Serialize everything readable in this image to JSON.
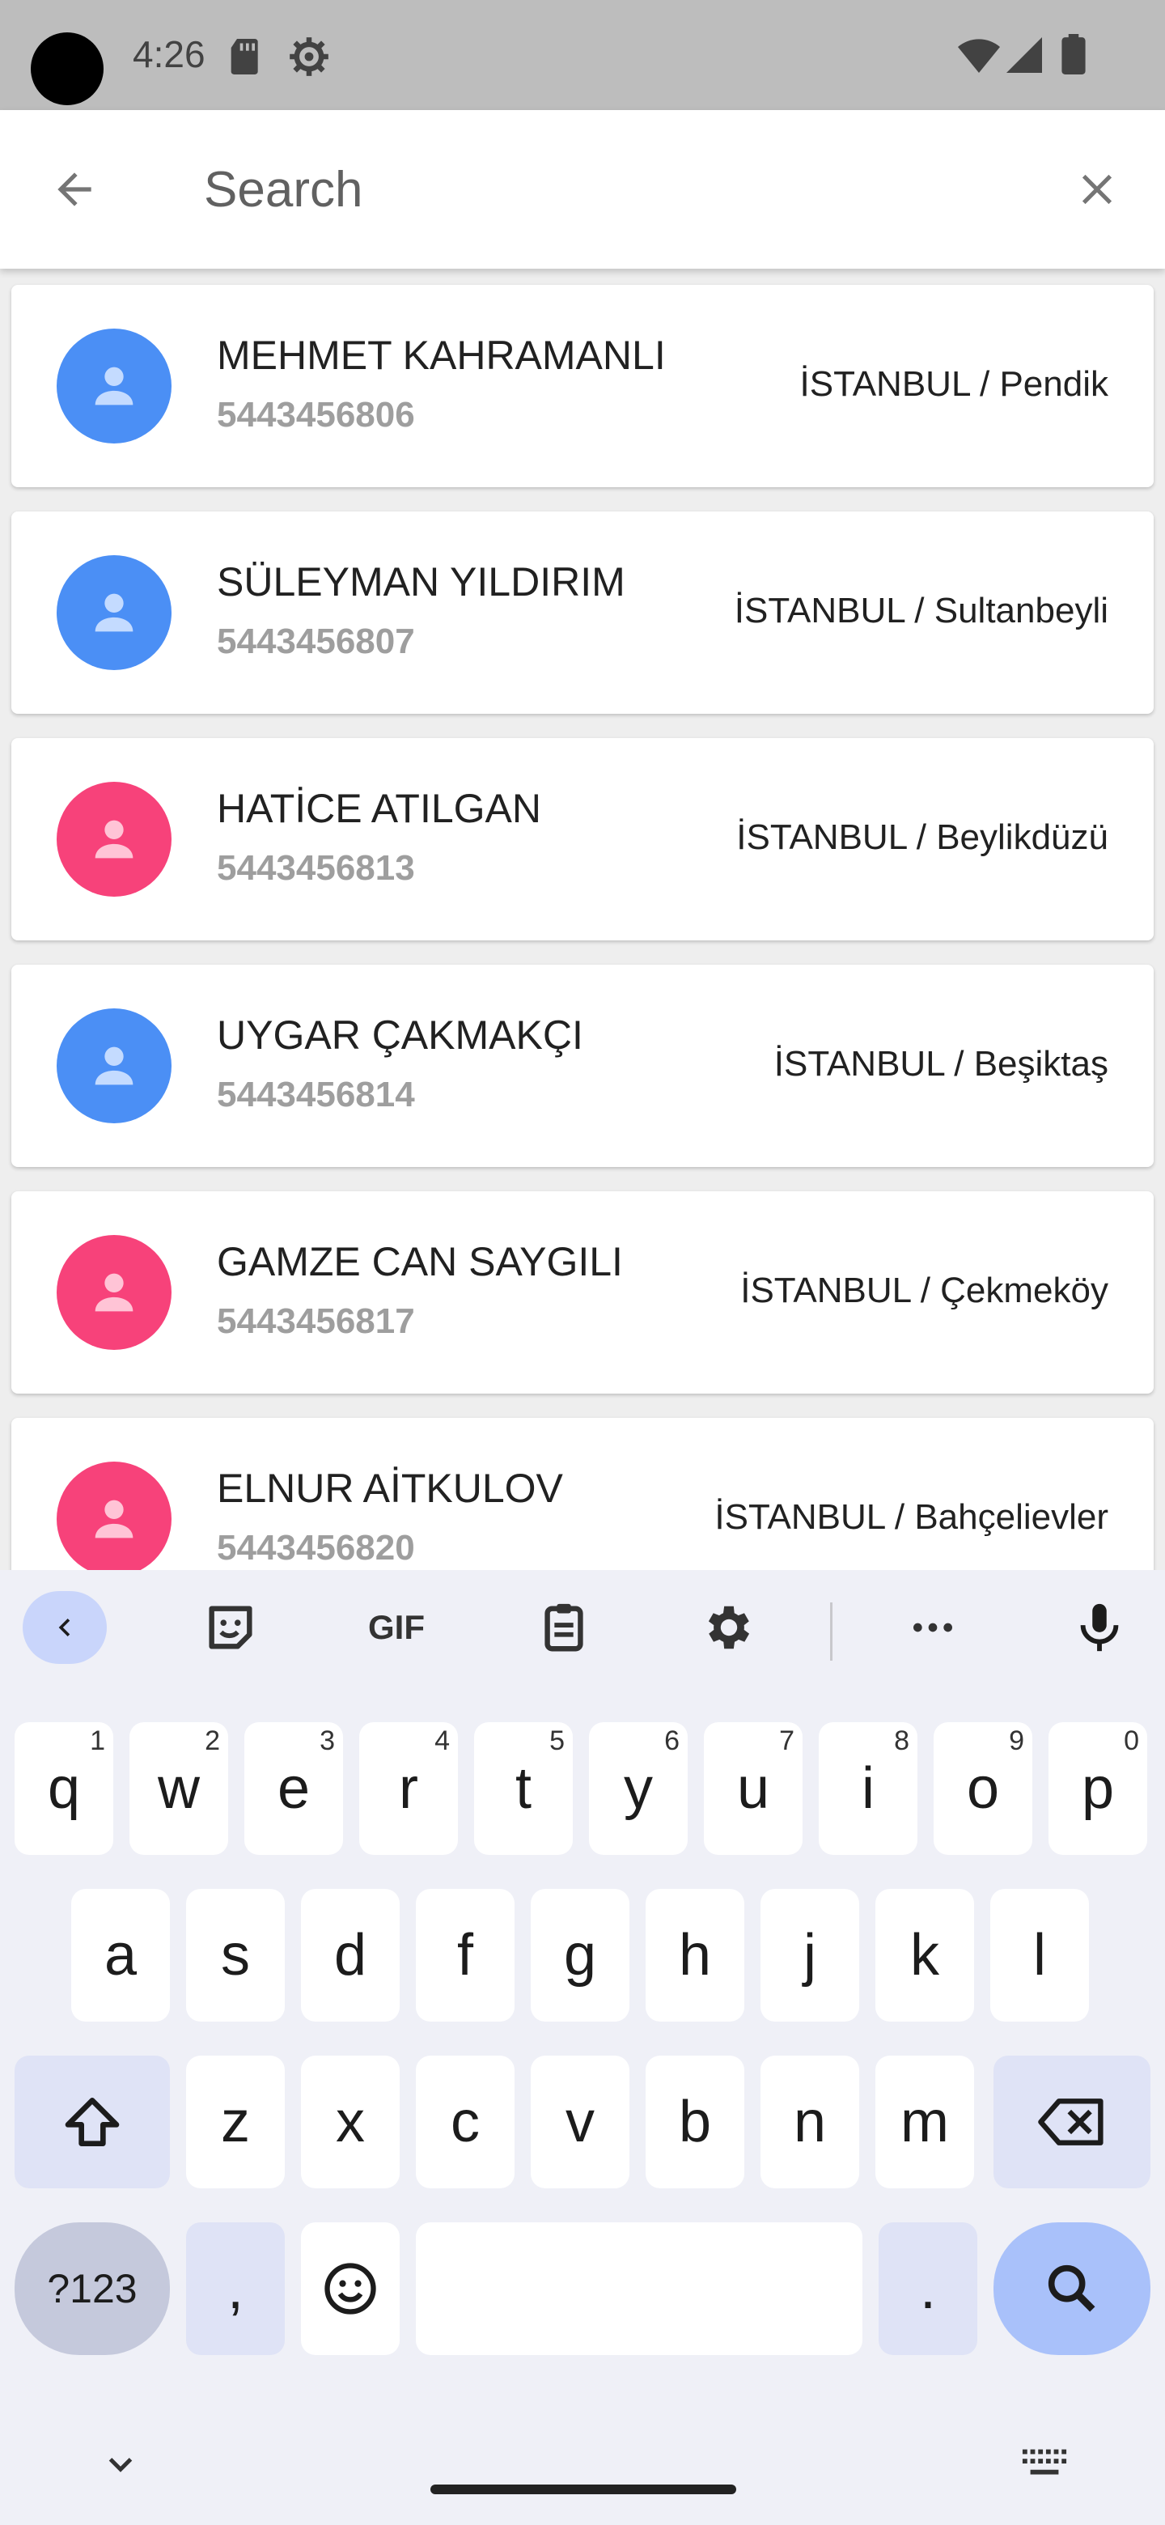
{
  "status_bar": {
    "time": "4:26"
  },
  "search": {
    "placeholder": "Search",
    "value": ""
  },
  "contacts": [
    {
      "name": "MEHMET KAHRAMANLI",
      "phone": "5443456806",
      "location": "İSTANBUL / Pendik",
      "avatar_color": "#4b8ff5"
    },
    {
      "name": "SÜLEYMAN YILDIRIM",
      "phone": "5443456807",
      "location": "İSTANBUL / Sultanbeyli",
      "avatar_color": "#4b8ff5"
    },
    {
      "name": "HATİCE ATILGAN",
      "phone": "5443456813",
      "location": "İSTANBUL / Beylikdüzü",
      "avatar_color": "#f7427a"
    },
    {
      "name": "UYGAR ÇAKMAKÇI",
      "phone": "5443456814",
      "location": "İSTANBUL / Beşiktaş",
      "avatar_color": "#4b8ff5"
    },
    {
      "name": "GAMZE CAN SAYGILI",
      "phone": "5443456817",
      "location": "İSTANBUL / Çekmeköy",
      "avatar_color": "#f7427a"
    },
    {
      "name": "ELNUR AİTKULOV",
      "phone": "5443456820",
      "location": "İSTANBUL / Bahçelievler",
      "avatar_color": "#f7427a"
    }
  ],
  "keyboard": {
    "toolbar": {
      "gif": "GIF"
    },
    "row1": [
      {
        "key": "q",
        "hint": "1"
      },
      {
        "key": "w",
        "hint": "2"
      },
      {
        "key": "e",
        "hint": "3"
      },
      {
        "key": "r",
        "hint": "4"
      },
      {
        "key": "t",
        "hint": "5"
      },
      {
        "key": "y",
        "hint": "6"
      },
      {
        "key": "u",
        "hint": "7"
      },
      {
        "key": "i",
        "hint": "8"
      },
      {
        "key": "o",
        "hint": "9"
      },
      {
        "key": "p",
        "hint": "0"
      }
    ],
    "row2": [
      "a",
      "s",
      "d",
      "f",
      "g",
      "h",
      "j",
      "k",
      "l"
    ],
    "row3": [
      "z",
      "x",
      "c",
      "v",
      "b",
      "n",
      "m"
    ],
    "symbols_label": "?123",
    "comma": ",",
    "period": "."
  }
}
